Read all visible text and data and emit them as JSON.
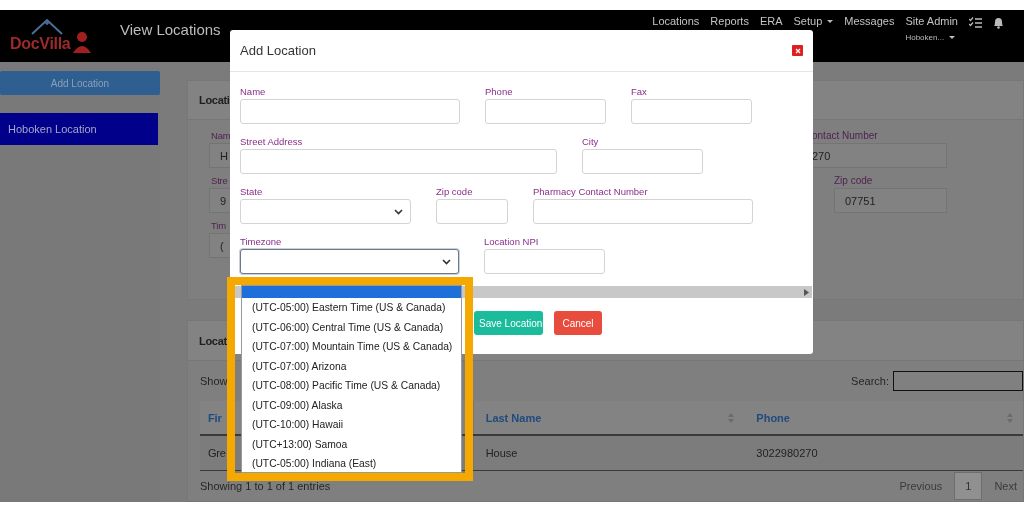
{
  "header": {
    "app_name": "DocVilla",
    "page_title": "View Locations",
    "nav": [
      {
        "label": "Locations",
        "has_menu": false
      },
      {
        "label": "Reports",
        "has_menu": false
      },
      {
        "label": "ERA",
        "has_menu": false
      },
      {
        "label": "Setup",
        "has_menu": true
      },
      {
        "label": "Messages",
        "has_menu": false
      }
    ],
    "user": {
      "name": "Site Admin",
      "location": "Hoboken...",
      "has_menu": true
    }
  },
  "sidebar": {
    "add_button": "Add Location",
    "items": [
      {
        "label": "Hoboken Location",
        "selected": true
      }
    ]
  },
  "location_card": {
    "title": "Locati",
    "left_fields": [
      {
        "label": "Nam",
        "value": "H"
      },
      {
        "label": "Stre",
        "value": "9"
      },
      {
        "label": "Tim",
        "value": "("
      }
    ],
    "right_fields": [
      {
        "label": "ontact Number",
        "value": "270"
      },
      {
        "label": "Zip code",
        "value": "07751"
      }
    ]
  },
  "list_card": {
    "title": "Locat",
    "show_label": "Show",
    "search_label": "Search:",
    "columns": [
      {
        "label": "Fir",
        "sortable": false
      },
      {
        "label": "Last Name",
        "sortable": true
      },
      {
        "label": "Phone",
        "sortable": true
      }
    ],
    "rows": [
      [
        "Gre",
        "House",
        "3022980270"
      ]
    ],
    "info": "Showing 1 to 1 of 1 entries",
    "pagination": {
      "previous": "Previous",
      "pages": [
        {
          "label": "1",
          "selected": true
        }
      ],
      "next": "Next"
    }
  },
  "modal": {
    "title": "Add Location",
    "field_rows": [
      [
        {
          "label": "Name",
          "kind": "text",
          "focused": false
        },
        {
          "label": "Phone",
          "kind": "text",
          "focused": false
        },
        {
          "label": "Fax",
          "kind": "text",
          "focused": false
        }
      ],
      [
        {
          "label": "Street Address",
          "kind": "text",
          "focused": false
        },
        {
          "label": "City",
          "kind": "text",
          "focused": false
        }
      ],
      [
        {
          "label": "State",
          "kind": "select",
          "focused": false
        },
        {
          "label": "Zip code",
          "kind": "text",
          "focused": false
        },
        {
          "label": "Pharmacy Contact Number",
          "kind": "text",
          "focused": false
        }
      ],
      [
        {
          "label": "Timezone",
          "kind": "select",
          "focused": true
        },
        {
          "label": "Location NPI",
          "kind": "text",
          "focused": false
        }
      ]
    ],
    "buttons": [
      {
        "label": "Save Location",
        "kind": "primary"
      },
      {
        "label": "Cancel",
        "kind": "danger"
      }
    ]
  },
  "timezone_dropdown": {
    "blank_option_selected": true,
    "options": [
      {
        "label": "(UTC-05:00) Eastern Time (US & Canada)",
        "selected": false
      },
      {
        "label": "(UTC-06:00) Central Time (US & Canada)",
        "selected": false
      },
      {
        "label": "(UTC-07:00) Mountain Time (US & Canada)",
        "selected": false
      },
      {
        "label": "(UTC-07:00) Arizona",
        "selected": false
      },
      {
        "label": "(UTC-08:00) Pacific Time (US & Canada)",
        "selected": false
      },
      {
        "label": "(UTC-09:00) Alaska",
        "selected": false
      },
      {
        "label": "(UTC-10:00) Hawaii",
        "selected": false
      },
      {
        "label": "(UTC+13:00) Samoa",
        "selected": false
      },
      {
        "label": "(UTC-05:00) Indiana (East)",
        "selected": false
      }
    ]
  }
}
